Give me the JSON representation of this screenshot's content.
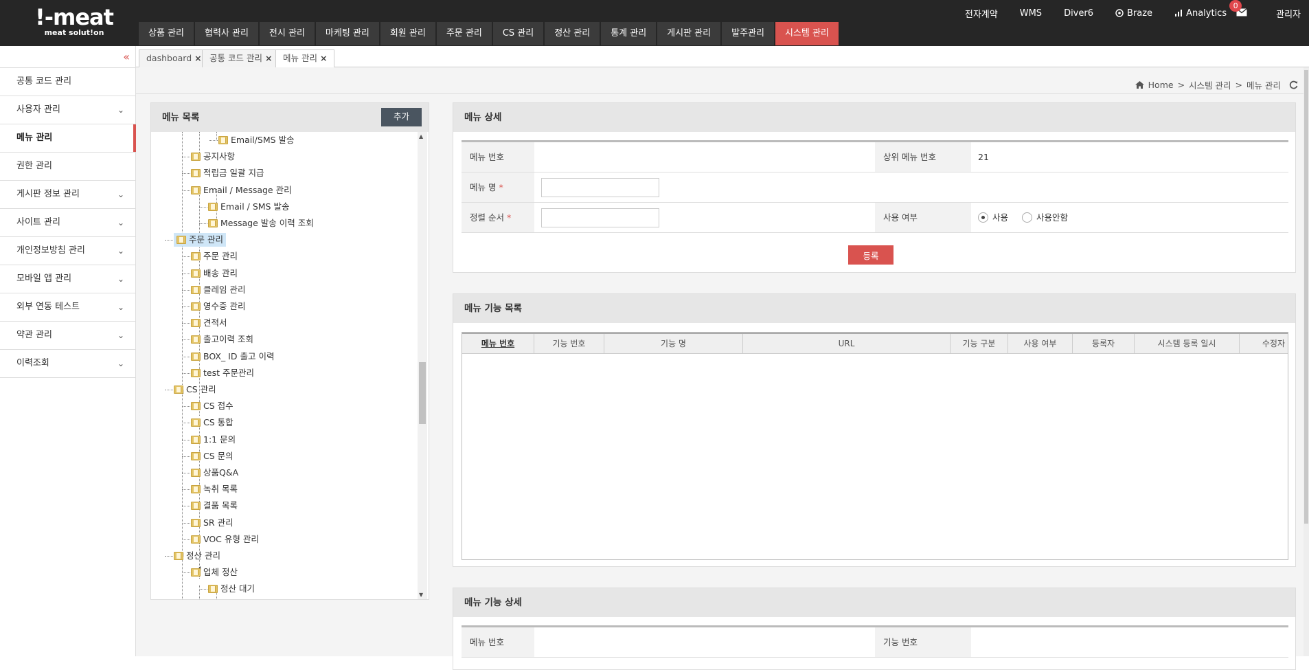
{
  "logo": {
    "main": "!-meat",
    "sub": "meat solut!on"
  },
  "util_nav": [
    {
      "label": "전자계약"
    },
    {
      "label": "WMS"
    },
    {
      "label": "Diver6"
    },
    {
      "label": "Braze"
    },
    {
      "label": "Analytics"
    }
  ],
  "notifications": {
    "count": "0"
  },
  "user": {
    "label": "관리자"
  },
  "main_nav": [
    {
      "label": "상품 관리"
    },
    {
      "label": "협력사 관리"
    },
    {
      "label": "전시 관리"
    },
    {
      "label": "마케팅 관리"
    },
    {
      "label": "회원 관리"
    },
    {
      "label": "주문 관리"
    },
    {
      "label": "CS 관리"
    },
    {
      "label": "정산 관리"
    },
    {
      "label": "통계 관리"
    },
    {
      "label": "게시판 관리"
    },
    {
      "label": "발주관리"
    },
    {
      "label": "시스템 관리"
    }
  ],
  "tabs": [
    {
      "label": "dashboard",
      "close": "×"
    },
    {
      "label": "공통 코드 관리",
      "close": "×"
    },
    {
      "label": "메뉴 관리",
      "close": "×"
    }
  ],
  "sidebar": {
    "collapse": "«",
    "items": [
      {
        "label": "공통 코드 관리",
        "chev": ""
      },
      {
        "label": "사용자 관리",
        "chev": "⌄"
      },
      {
        "label": "메뉴 관리",
        "chev": ""
      },
      {
        "label": "권한 관리",
        "chev": ""
      },
      {
        "label": "게시판 정보 관리",
        "chev": "⌄"
      },
      {
        "label": "사이트 관리",
        "chev": "⌄"
      },
      {
        "label": "개인정보방침 관리",
        "chev": "⌄"
      },
      {
        "label": "모바일 앱 관리",
        "chev": "⌄"
      },
      {
        "label": "외부 연동 테스트",
        "chev": "⌄"
      },
      {
        "label": "약관 관리",
        "chev": "⌄"
      },
      {
        "label": "이력조회",
        "chev": "⌄"
      }
    ]
  },
  "breadcrumb": {
    "home": "Home",
    "sep": ">",
    "level1": "시스템 관리",
    "level2": "메뉴 관리"
  },
  "menu_list": {
    "title": "메뉴 목록",
    "add_label": "추가",
    "nodes": [
      {
        "label": "Email/SMS 발송"
      },
      {
        "label": "공지사항"
      },
      {
        "label": "적립금 일괄 지급"
      },
      {
        "label": "Email / Message 관리"
      },
      {
        "label": "Email / SMS 발송"
      },
      {
        "label": "Message 발송 이력 조회"
      },
      {
        "label": "주문 관리"
      },
      {
        "label": "주문 관리"
      },
      {
        "label": "배송 관리"
      },
      {
        "label": "클레임 관리"
      },
      {
        "label": "영수증 관리"
      },
      {
        "label": "견적서"
      },
      {
        "label": "출고이력 조회"
      },
      {
        "label": "BOX_ ID 출고 이력"
      },
      {
        "label": "test 주문관리"
      },
      {
        "label": "CS 관리"
      },
      {
        "label": "CS 접수"
      },
      {
        "label": "CS 통합"
      },
      {
        "label": "1:1 문의"
      },
      {
        "label": "CS 문의"
      },
      {
        "label": "상품Q&A"
      },
      {
        "label": "녹취 목록"
      },
      {
        "label": "결품 목록"
      },
      {
        "label": "SR 관리"
      },
      {
        "label": "VOC 유형 관리"
      },
      {
        "label": "정산 관리"
      },
      {
        "label": "업체 정산"
      },
      {
        "label": "정산 대기"
      }
    ]
  },
  "menu_detail": {
    "title": "메뉴 상세",
    "menu_no_label": "메뉴 번호",
    "menu_no_value": "",
    "parent_no_label": "상위 메뉴 번호",
    "parent_no_value": "21",
    "menu_name_label": "메뉴 명",
    "menu_name_value": "",
    "sort_label": "정렬 순서",
    "sort_value": "",
    "required_mark": "*",
    "use_label": "사용 여부",
    "use_yes": "사용",
    "use_no": "사용안함",
    "register_label": "등록"
  },
  "function_list": {
    "title": "메뉴 기능 목록",
    "columns": [
      "메뉴 번호",
      "기능 번호",
      "기능 명",
      "URL",
      "기능 구분",
      "사용 여부",
      "등록자",
      "시스템 등록 일시",
      "수정자"
    ]
  },
  "function_detail": {
    "title": "메뉴 기능 상세",
    "menu_no_label": "메뉴 번호",
    "func_no_label": "기능 번호"
  },
  "colors": {
    "accent": "#d9534f",
    "topbar": "#262626",
    "nav_button": "#3b3b3b"
  }
}
